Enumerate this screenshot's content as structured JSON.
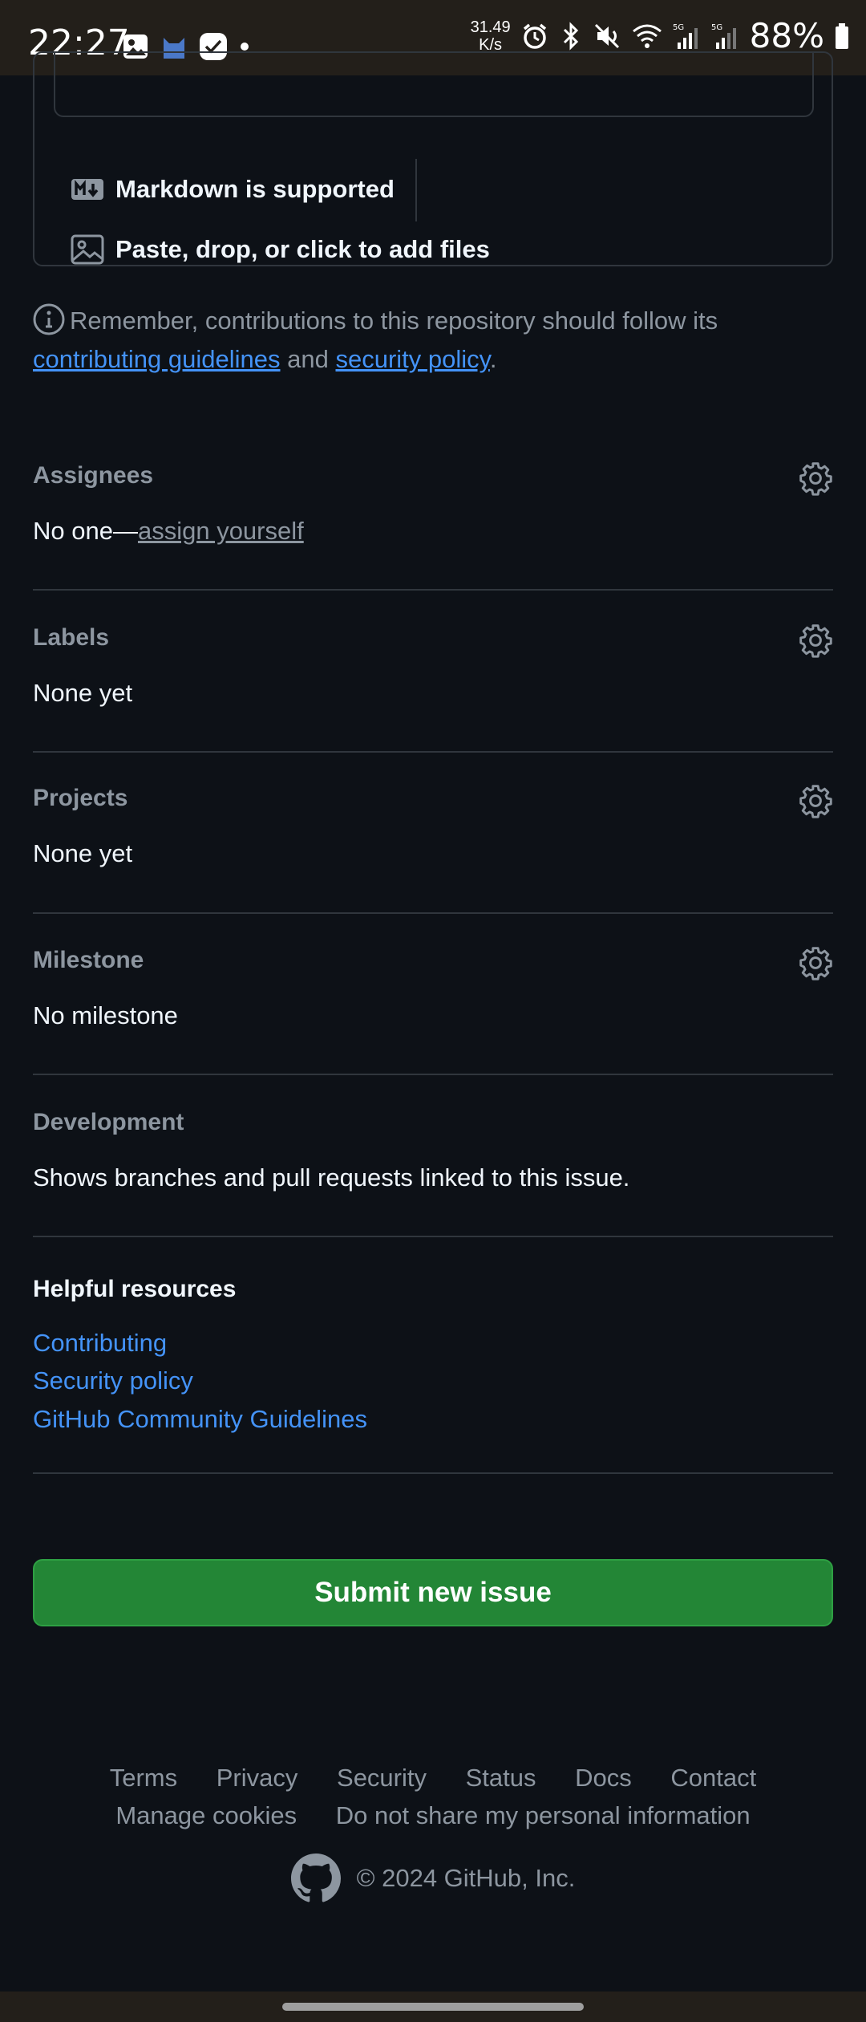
{
  "status_bar": {
    "time": "22:27",
    "speed_top": "31.49",
    "speed_bottom": "K/s",
    "battery": "88%",
    "icons": [
      "gallery-icon",
      "cat-icon",
      "checkmark-app-icon",
      "dot-icon",
      "alarm-icon",
      "bluetooth-icon",
      "mute-icon",
      "wifi-icon",
      "signal-5g-icon",
      "signal-5g-icon",
      "battery-icon"
    ]
  },
  "editor": {
    "markdown_label": "Markdown is supported",
    "attach_label": "Paste, drop, or click to add files"
  },
  "note": {
    "prefix": "Remember, contributions to this repository should follow its",
    "link1": "contributing guidelines",
    "middle": "and",
    "link2": "security policy",
    "suffix": "."
  },
  "sidebar": {
    "assignees": {
      "title": "Assignees",
      "value_prefix": "No one—",
      "value_link": "assign yourself"
    },
    "labels": {
      "title": "Labels",
      "value": "None yet"
    },
    "projects": {
      "title": "Projects",
      "value": "None yet"
    },
    "milestone": {
      "title": "Milestone",
      "value": "No milestone"
    },
    "development": {
      "title": "Development",
      "value": "Shows branches and pull requests linked to this issue."
    }
  },
  "resources": {
    "title": "Helpful resources",
    "links": [
      "Contributing",
      "Security policy",
      "GitHub Community Guidelines"
    ]
  },
  "submit": {
    "label": "Submit new issue"
  },
  "footer": {
    "row1": [
      "Terms",
      "Privacy",
      "Security",
      "Status",
      "Docs",
      "Contact"
    ],
    "row2": [
      "Manage cookies",
      "Do not share my personal information"
    ],
    "copyright": "© 2024 GitHub, Inc."
  },
  "colors": {
    "accent_link": "#4493f8",
    "submit_green": "#238636",
    "background": "#0d1117"
  }
}
